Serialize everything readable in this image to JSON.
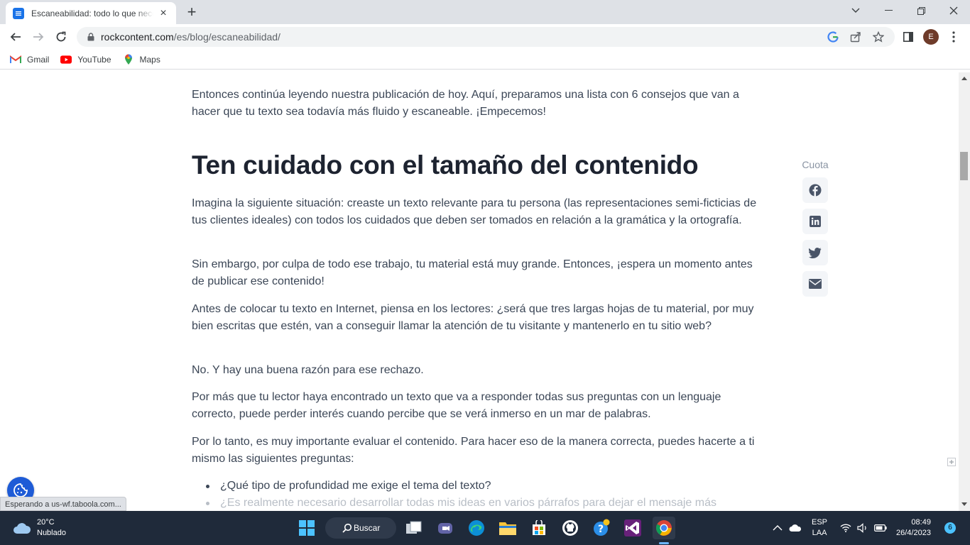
{
  "browser": {
    "tab_title": "Escaneabilidad: todo lo que necesitas saber",
    "url_domain": "rockcontent.com",
    "url_path": "/es/blog/escaneabilidad/",
    "profile_initial": "E",
    "bookmarks": [
      {
        "label": "Gmail",
        "icon": "gmail-icon"
      },
      {
        "label": "YouTube",
        "icon": "youtube-icon"
      },
      {
        "label": "Maps",
        "icon": "maps-icon"
      }
    ]
  },
  "article": {
    "intro": "Entonces continúa leyendo nuestra publicación de hoy. Aquí, preparamos una lista con 6 consejos que van a hacer que tu texto sea todavía más fluido y escaneable. ¡Empecemos!",
    "heading": "Ten cuidado con el tamaño del contenido",
    "paragraphs": [
      "Imagina la siguiente situación: creaste un texto relevante para tu persona (las representaciones semi-ficticias de tus clientes ideales) con todos los cuidados que deben ser tomados en relación a la gramática y la ortografía.",
      "Sin embargo, por culpa de todo ese trabajo, tu material está muy grande. Entonces, ¡espera un momento antes de publicar ese contenido!",
      "Antes de colocar tu texto en Internet, piensa en los lectores: ¿será que tres largas hojas de tu material, por muy bien escritas que estén, van a conseguir llamar la atención de tu visitante y mantenerlo en tu sitio web?",
      "No. Y hay una buena razón para ese rechazo.",
      "Por más que tu lector haya encontrado un texto que va a responder todas sus preguntas con un lenguaje correcto, puede perder interés cuando percibe que se verá inmerso en un mar de palabras.",
      "Por lo tanto, es muy importante evaluar el contenido. Para hacer eso de la manera correcta, puedes hacerte a ti mismo las siguientes preguntas:"
    ],
    "bullets": [
      "¿Qué tipo de profundidad me exige el tema del texto?",
      "¿Es realmente necesario desarrollar todas mis ideas en varios párrafos para dejar el mensaje más"
    ]
  },
  "share": {
    "label": "Cuota",
    "buttons": [
      "facebook-icon",
      "linkedin-icon",
      "twitter-icon",
      "email-icon"
    ]
  },
  "status_text": "Esperando a us-wf.taboola.com...",
  "taskbar": {
    "temperature": "20°C",
    "weather": "Nublado",
    "search_label": "Buscar",
    "lang_top": "ESP",
    "lang_bottom": "LAA",
    "time": "08:49",
    "date": "26/4/2023",
    "notifications": "6"
  }
}
